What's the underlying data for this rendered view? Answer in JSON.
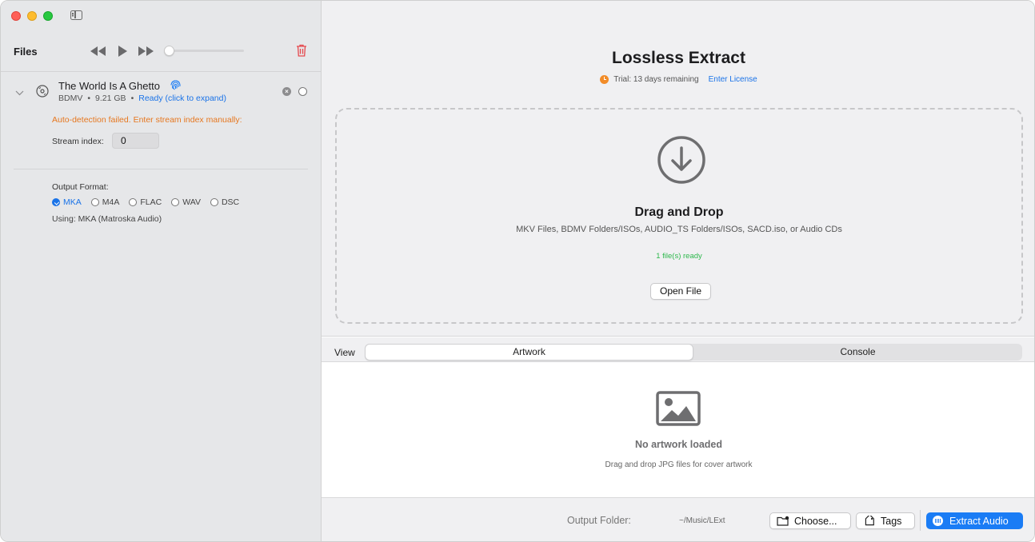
{
  "sidebar": {
    "title": "Files",
    "file": {
      "name": "The World Is A Ghetto",
      "type": "BDMV",
      "size": "9.21 GB",
      "status": "Ready (click to expand)",
      "warning": "Auto-detection failed. Enter stream index manually:",
      "stream_label": "Stream index:",
      "stream_value": "0"
    },
    "output_format": {
      "label": "Output Format:",
      "options": [
        "MKA",
        "M4A",
        "FLAC",
        "WAV",
        "DSC"
      ],
      "selected": "MKA",
      "using": "Using: MKA (Matroska Audio)"
    },
    "playback_progress": 0
  },
  "header": {
    "title": "Lossless Extract",
    "trial": "Trial: 13 days remaining",
    "license_link": "Enter License"
  },
  "dropzone": {
    "title": "Drag and Drop",
    "subtitle": "MKV Files, BDMV Folders/ISOs, AUDIO_TS Folders/ISOs, SACD.iso, or Audio CDs",
    "ready": "1 file(s) ready",
    "open_button": "Open File"
  },
  "view": {
    "label": "View",
    "tabs": [
      "Artwork",
      "Console"
    ],
    "selected": "Artwork"
  },
  "artwork": {
    "empty_title": "No artwork loaded",
    "hint": "Drag and drop JPG files for cover artwork"
  },
  "bottom": {
    "output_folder_label": "Output Folder:",
    "output_folder_path": "~/Music/LExt",
    "choose_button": "Choose...",
    "tags_button": "Tags",
    "extract_button": "Extract Audio"
  },
  "colors": {
    "accent": "#1a7cf5",
    "warning": "#e6771f",
    "success": "#2db84c",
    "trash": "#e5484d"
  }
}
